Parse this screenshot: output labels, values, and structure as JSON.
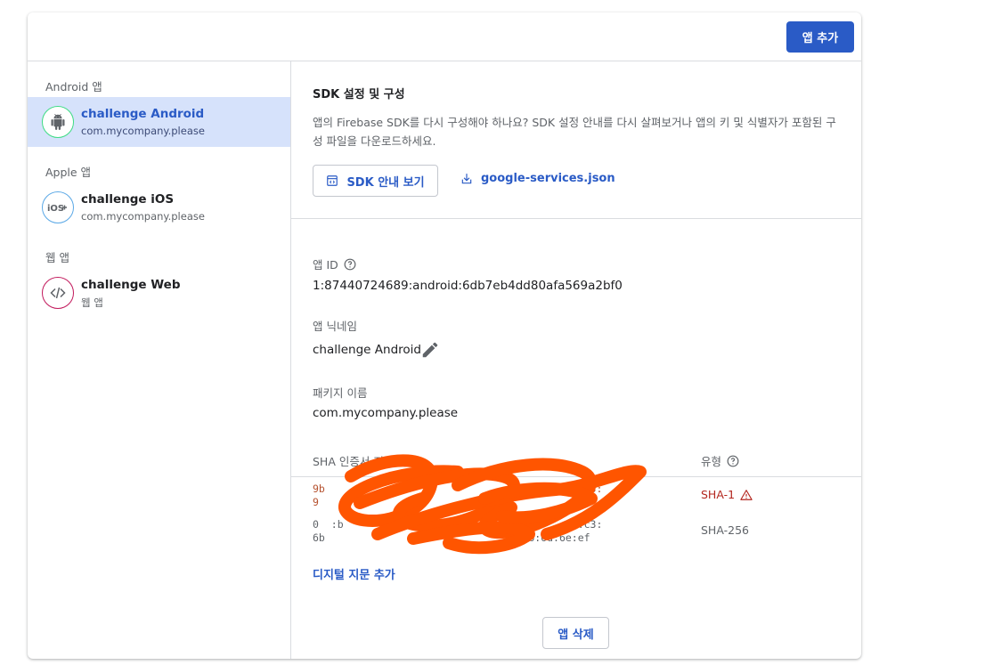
{
  "header": {
    "add_app_label": "앱 추가"
  },
  "sidebar": {
    "groups": [
      {
        "label": "Android 앱",
        "app": {
          "name": "challenge Android",
          "sub": "com.mycompany.please",
          "icon": "android-icon"
        }
      },
      {
        "label": "Apple 앱",
        "app": {
          "name": "challenge iOS",
          "sub": "com.mycompany.please",
          "icon": "ios-icon"
        }
      },
      {
        "label": "웹 앱",
        "app": {
          "name": "challenge Web",
          "sub": "웹 앱",
          "icon": "code-icon"
        }
      }
    ]
  },
  "main": {
    "sdk": {
      "title": "SDK 설정 및 구성",
      "description": "앱의 Firebase SDK를 다시 구성해야 하나요? SDK 설정 안내를 다시 살펴보거나 앱의 키 및 식별자가 포함된 구성 파일을 다운로드하세요.",
      "view_button": "SDK 안내 보기",
      "download_link": "google-services.json"
    },
    "app_id": {
      "label": "앱 ID",
      "value": "1:87440724689:android:6db7eb4dd80afa569a2bf0"
    },
    "nickname": {
      "label": "앱 닉네임",
      "value": "challenge Android"
    },
    "package": {
      "label": "패키지 이름",
      "value": "com.mycompany.please"
    },
    "sha": {
      "header_fingerprint": "SHA 인증서 지문",
      "header_type": "유형",
      "rows": [
        {
          "line1": "9b                                    3:   :c3:",
          "line2": "9                                             ",
          "type": "SHA-1",
          "status": "warning"
        },
        {
          "line1": "0  :b                                   :74:c3:",
          "line2": "6b                                7b:6d:6e:ef",
          "type": "SHA-256",
          "status": "normal"
        }
      ]
    },
    "add_fingerprint_label": "디지털 지문 추가",
    "delete_app_label": "앱 삭제"
  },
  "colors": {
    "accent": "#2a5bc6",
    "selected_bg": "#d6e2fb",
    "warning": "#b3261e",
    "redaction": "#ff5500"
  }
}
